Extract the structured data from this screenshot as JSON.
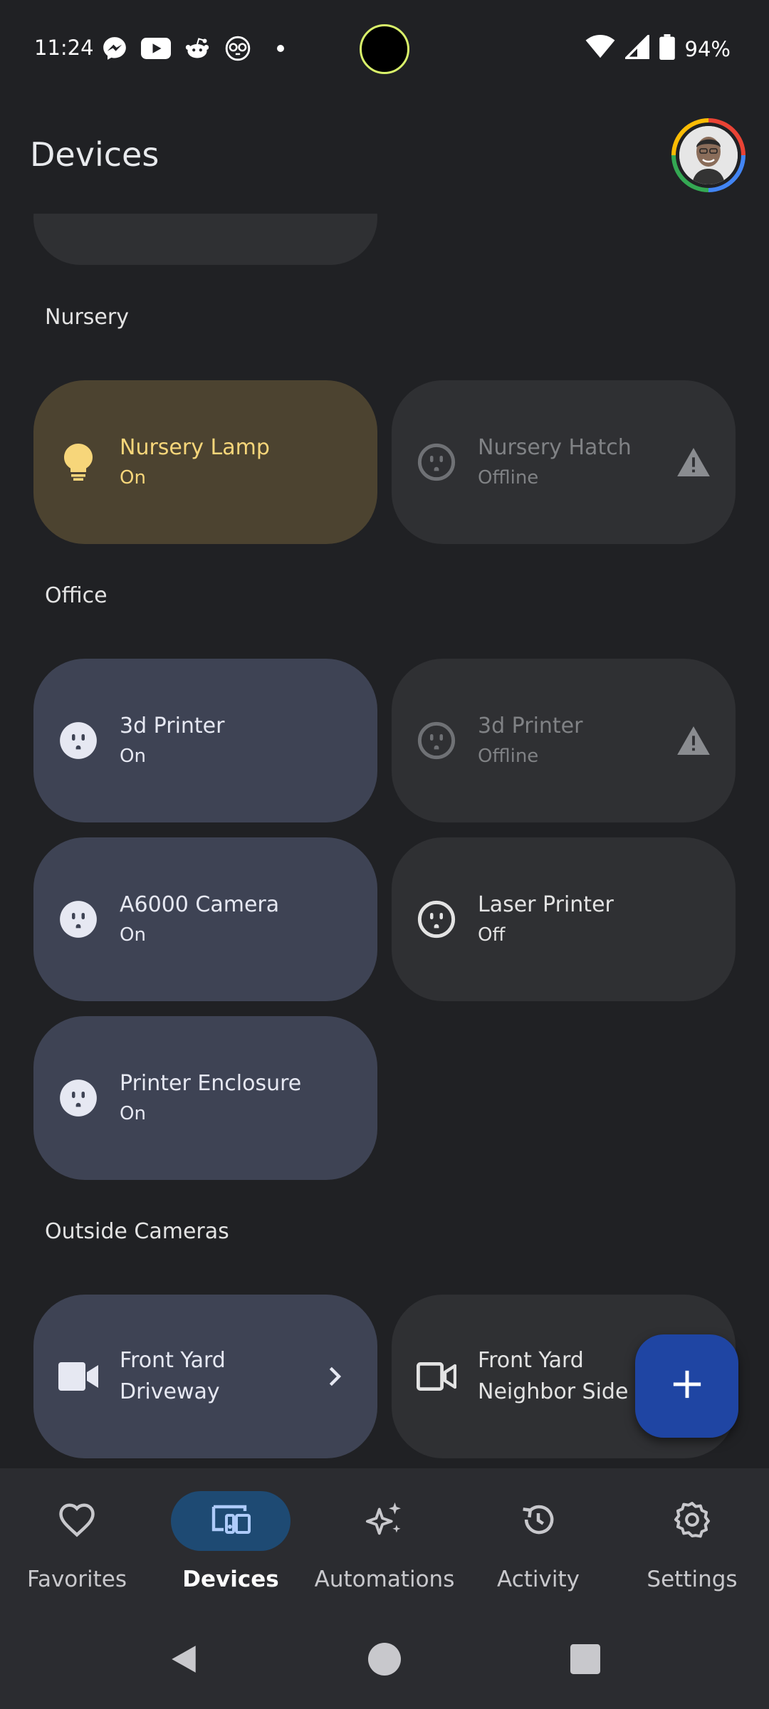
{
  "status_bar": {
    "time": "11:24",
    "battery": "94%",
    "notification_icons": [
      "messenger-icon",
      "youtube-icon",
      "reddit-icon",
      "owl-icon",
      "dot-icon"
    ]
  },
  "header": {
    "title": "Devices"
  },
  "sections": [
    {
      "label": "Nursery",
      "devices": [
        {
          "name": "Nursery Lamp",
          "status": "On",
          "icon": "lightbulb-icon",
          "state": "on"
        },
        {
          "name": "Nursery Hatch",
          "status": "Offline",
          "icon": "outlet-icon",
          "state": "offline",
          "trailing_icon": "warning-icon"
        }
      ]
    },
    {
      "label": "Office",
      "devices": [
        {
          "name": "3d Printer",
          "status": "On",
          "icon": "outlet-icon",
          "state": "on"
        },
        {
          "name": "3d Printer",
          "status": "Offline",
          "icon": "outlet-icon",
          "state": "offline",
          "trailing_icon": "warning-icon"
        },
        {
          "name": "A6000 Camera",
          "status": "On",
          "icon": "outlet-icon",
          "state": "on"
        },
        {
          "name": "Laser Printer",
          "status": "Off",
          "icon": "outlet-icon",
          "state": "off"
        },
        {
          "name": "Printer Enclosure",
          "status": "On",
          "icon": "outlet-icon",
          "state": "on"
        }
      ]
    },
    {
      "label": "Outside Cameras",
      "devices": [
        {
          "name_line1": "Front Yard",
          "name_line2": "Driveway",
          "icon": "video-camera-icon",
          "state": "on",
          "trailing_icon": "chevron-right-icon"
        },
        {
          "name_line1": "Front Yard",
          "name_line2": "Neighbor Side",
          "icon": "video-camera-outline-icon",
          "state": "off"
        }
      ]
    }
  ],
  "fab": {
    "icon": "plus-icon"
  },
  "bottom_nav": [
    {
      "label": "Favorites",
      "icon": "heart-icon"
    },
    {
      "label": "Devices",
      "icon": "devices-icon",
      "selected": true
    },
    {
      "label": "Automations",
      "icon": "sparkle-icon"
    },
    {
      "label": "Activity",
      "icon": "history-icon"
    },
    {
      "label": "Settings",
      "icon": "gear-icon"
    }
  ],
  "colors": {
    "background": "#202124",
    "lamp_tile": "#4c4330",
    "lamp_text": "#f7d67a",
    "on_tile": "#3e4354",
    "off_tile": "#2f3033",
    "fab": "#1f45a3",
    "nav_selected": "#1e4a73"
  }
}
